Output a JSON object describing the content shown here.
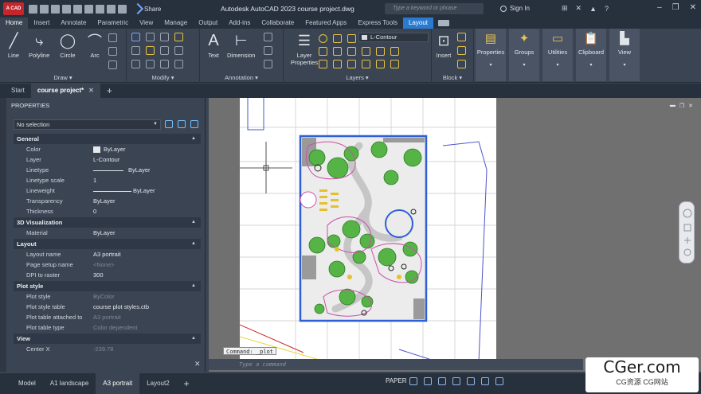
{
  "titlebar": {
    "logo": "A CAD",
    "share_label": "Share",
    "title": "Autodesk AutoCAD 2023   course project.dwg",
    "search_placeholder": "Type a keyword or phrase",
    "signin": "Sign In"
  },
  "ribbon_tabs": [
    "Home",
    "Insert",
    "Annotate",
    "Parametric",
    "View",
    "Manage",
    "Output",
    "Add-ins",
    "Collaborate",
    "Featured Apps",
    "Express Tools",
    "Layout"
  ],
  "ribbon": {
    "draw": {
      "label": "Draw",
      "tools": [
        "Line",
        "Polyline",
        "Circle",
        "Arc"
      ]
    },
    "modify": {
      "label": "Modify"
    },
    "annotation": {
      "label": "Annotation",
      "tools": [
        "Text",
        "Dimension"
      ]
    },
    "layers": {
      "label": "Layers",
      "layer_properties": "Layer Properties",
      "current_layer": "L-Contour"
    },
    "block": {
      "label": "Block",
      "insert": "Insert"
    },
    "side_panels": [
      "Properties",
      "Groups",
      "Utilities",
      "Clipboard",
      "View"
    ]
  },
  "doc_tabs": [
    "Start",
    "course project*"
  ],
  "properties": {
    "title": "PROPERTIES",
    "selection": "No selection",
    "sections": [
      {
        "name": "General",
        "rows": [
          {
            "k": "Color",
            "v": "ByLayer"
          },
          {
            "k": "Layer",
            "v": "L-Contour"
          },
          {
            "k": "Linetype",
            "v": "ByLayer"
          },
          {
            "k": "Linetype scale",
            "v": "1"
          },
          {
            "k": "Lineweight",
            "v": "ByLayer"
          },
          {
            "k": "Transparency",
            "v": "ByLayer"
          },
          {
            "k": "Thickness",
            "v": "0"
          }
        ]
      },
      {
        "name": "3D Visualization",
        "rows": [
          {
            "k": "Material",
            "v": "ByLayer"
          }
        ]
      },
      {
        "name": "Layout",
        "rows": [
          {
            "k": "Layout name",
            "v": "A3 portrait"
          },
          {
            "k": "Page setup name",
            "v": "<None>"
          },
          {
            "k": "DPI to raster",
            "v": "300"
          }
        ]
      },
      {
        "name": "Plot style",
        "rows": [
          {
            "k": "Plot style",
            "v": "ByColor"
          },
          {
            "k": "Plot style table",
            "v": "course plot styles.ctb"
          },
          {
            "k": "Plot table attached to",
            "v": "A3 portrait"
          },
          {
            "k": "Plot table type",
            "v": "Color dependent"
          }
        ]
      },
      {
        "name": "View",
        "rows": [
          {
            "k": "Center X",
            "v": "-239.78"
          }
        ]
      }
    ]
  },
  "command": {
    "history": "Command: _plot",
    "placeholder": "Type a command"
  },
  "layout_tabs": [
    "Model",
    "A1 landscape",
    "A3 portrait",
    "Layout2"
  ],
  "status": {
    "space": "PAPER"
  },
  "watermark": {
    "line1": "CGer.com",
    "line2": "CG资源 CG网站"
  },
  "colors": {
    "accent": "#2a7bd0",
    "plan_border": "#2d5fd6",
    "tree_green": "#55b445",
    "pink_outline": "#c94fa6"
  }
}
